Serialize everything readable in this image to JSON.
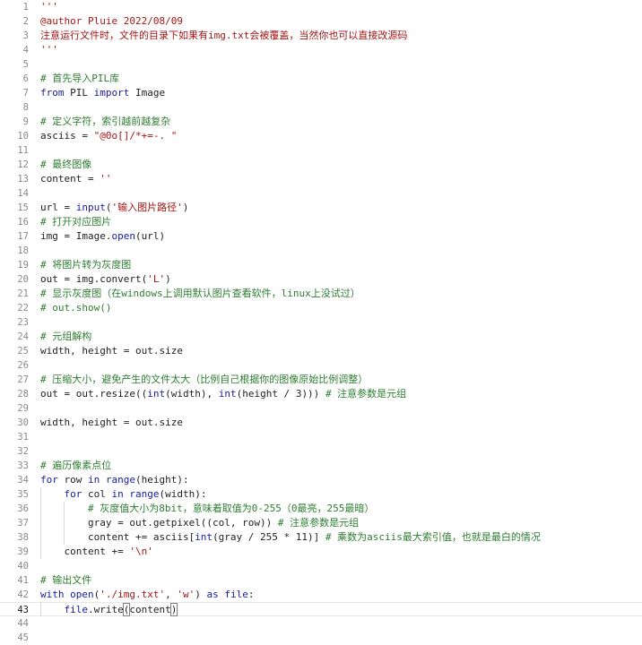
{
  "editor": {
    "colors": {
      "comment": "#2e7d32",
      "keyword": "#1a1aa6",
      "string": "#a31515",
      "plain": "#1f1f1f",
      "builtin": "#1a1aa6",
      "line_number": "#8a8a8a"
    },
    "current_line": 43,
    "lines": [
      {
        "n": 1,
        "tokens": [
          {
            "t": "'''",
            "c": "string"
          }
        ]
      },
      {
        "n": 2,
        "tokens": [
          {
            "t": "@author Pluie 2022/08/09",
            "c": "string"
          }
        ]
      },
      {
        "n": 3,
        "tokens": [
          {
            "t": "注意运行文件时，文件的目录下如果有img.txt会被覆盖，当然你也可以直接改源码",
            "c": "string"
          }
        ]
      },
      {
        "n": 4,
        "tokens": [
          {
            "t": "'''",
            "c": "string"
          }
        ]
      },
      {
        "n": 5,
        "tokens": []
      },
      {
        "n": 6,
        "tokens": [
          {
            "t": "# 首先导入PIL库",
            "c": "comment"
          }
        ]
      },
      {
        "n": 7,
        "tokens": [
          {
            "t": "from",
            "c": "keyword"
          },
          {
            "t": " PIL ",
            "c": "plain"
          },
          {
            "t": "import",
            "c": "keyword"
          },
          {
            "t": " Image",
            "c": "plain"
          }
        ]
      },
      {
        "n": 8,
        "tokens": []
      },
      {
        "n": 9,
        "tokens": [
          {
            "t": "# 定义字符，索引越前越复杂",
            "c": "comment"
          }
        ]
      },
      {
        "n": 10,
        "tokens": [
          {
            "t": "asciis = ",
            "c": "plain"
          },
          {
            "t": "\"@0o[]/*+=-. \"",
            "c": "string"
          }
        ]
      },
      {
        "n": 11,
        "tokens": []
      },
      {
        "n": 12,
        "tokens": [
          {
            "t": "# 最终图像",
            "c": "comment"
          }
        ]
      },
      {
        "n": 13,
        "tokens": [
          {
            "t": "content = ",
            "c": "plain"
          },
          {
            "t": "''",
            "c": "string"
          }
        ]
      },
      {
        "n": 14,
        "tokens": []
      },
      {
        "n": 15,
        "tokens": [
          {
            "t": "url = ",
            "c": "plain"
          },
          {
            "t": "input",
            "c": "builtin"
          },
          {
            "t": "(",
            "c": "plain"
          },
          {
            "t": "'输入图片路径'",
            "c": "string"
          },
          {
            "t": ")",
            "c": "plain"
          }
        ]
      },
      {
        "n": 16,
        "tokens": [
          {
            "t": "# 打开对应图片",
            "c": "comment"
          }
        ]
      },
      {
        "n": 17,
        "tokens": [
          {
            "t": "img = Image.",
            "c": "plain"
          },
          {
            "t": "open",
            "c": "builtin"
          },
          {
            "t": "(url)",
            "c": "plain"
          }
        ]
      },
      {
        "n": 18,
        "tokens": []
      },
      {
        "n": 19,
        "tokens": [
          {
            "t": "# 将图片转为灰度图",
            "c": "comment"
          }
        ]
      },
      {
        "n": 20,
        "tokens": [
          {
            "t": "out = img.convert(",
            "c": "plain"
          },
          {
            "t": "'L'",
            "c": "string"
          },
          {
            "t": ")",
            "c": "plain"
          }
        ]
      },
      {
        "n": 21,
        "tokens": [
          {
            "t": "# 显示灰度图（在windows上调用默认图片查看软件，linux上没试过）",
            "c": "comment"
          }
        ]
      },
      {
        "n": 22,
        "tokens": [
          {
            "t": "# out.show()",
            "c": "comment"
          }
        ]
      },
      {
        "n": 23,
        "tokens": []
      },
      {
        "n": 24,
        "tokens": [
          {
            "t": "# 元组解构",
            "c": "comment"
          }
        ]
      },
      {
        "n": 25,
        "tokens": [
          {
            "t": "width, height = out.size",
            "c": "plain"
          }
        ]
      },
      {
        "n": 26,
        "tokens": []
      },
      {
        "n": 27,
        "tokens": [
          {
            "t": "# 压缩大小，避免产生的文件太大（比例自己根据你的图像原始比例调整）",
            "c": "comment"
          }
        ]
      },
      {
        "n": 28,
        "tokens": [
          {
            "t": "out = out.resize((",
            "c": "plain"
          },
          {
            "t": "int",
            "c": "builtin"
          },
          {
            "t": "(width), ",
            "c": "plain"
          },
          {
            "t": "int",
            "c": "builtin"
          },
          {
            "t": "(height / ",
            "c": "plain"
          },
          {
            "t": "3",
            "c": "plain"
          },
          {
            "t": "))) ",
            "c": "plain"
          },
          {
            "t": "# 注意参数是元组",
            "c": "comment"
          }
        ]
      },
      {
        "n": 29,
        "tokens": []
      },
      {
        "n": 30,
        "tokens": [
          {
            "t": "width, height = out.size",
            "c": "plain"
          }
        ]
      },
      {
        "n": 31,
        "tokens": []
      },
      {
        "n": 32,
        "tokens": []
      },
      {
        "n": 33,
        "tokens": [
          {
            "t": "# 遍历像素点位",
            "c": "comment"
          }
        ]
      },
      {
        "n": 34,
        "tokens": [
          {
            "t": "for",
            "c": "keyword"
          },
          {
            "t": " row ",
            "c": "plain"
          },
          {
            "t": "in",
            "c": "keyword"
          },
          {
            "t": " ",
            "c": "plain"
          },
          {
            "t": "range",
            "c": "builtin"
          },
          {
            "t": "(height):",
            "c": "plain"
          }
        ]
      },
      {
        "n": 35,
        "tokens": [
          {
            "t": "    ",
            "c": "plain"
          },
          {
            "t": "for",
            "c": "keyword"
          },
          {
            "t": " col ",
            "c": "plain"
          },
          {
            "t": "in",
            "c": "keyword"
          },
          {
            "t": " ",
            "c": "plain"
          },
          {
            "t": "range",
            "c": "builtin"
          },
          {
            "t": "(width):",
            "c": "plain"
          }
        ]
      },
      {
        "n": 36,
        "tokens": [
          {
            "t": "        ",
            "c": "plain"
          },
          {
            "t": "# 灰度值大小为8bit，意味着取值为0-255（0最亮，255最暗）",
            "c": "comment"
          }
        ]
      },
      {
        "n": 37,
        "tokens": [
          {
            "t": "        gray = out.getpixel((col, row)) ",
            "c": "plain"
          },
          {
            "t": "# 注意参数是元组",
            "c": "comment"
          }
        ]
      },
      {
        "n": 38,
        "tokens": [
          {
            "t": "        content += asciis[",
            "c": "plain"
          },
          {
            "t": "int",
            "c": "builtin"
          },
          {
            "t": "(gray / ",
            "c": "plain"
          },
          {
            "t": "255",
            "c": "plain"
          },
          {
            "t": " * ",
            "c": "plain"
          },
          {
            "t": "11",
            "c": "plain"
          },
          {
            "t": ")] ",
            "c": "plain"
          },
          {
            "t": "# 乘数为asciis最大索引值，也就是最白的情况",
            "c": "comment"
          }
        ]
      },
      {
        "n": 39,
        "tokens": [
          {
            "t": "    content += ",
            "c": "plain"
          },
          {
            "t": "'\\n'",
            "c": "string"
          }
        ]
      },
      {
        "n": 40,
        "tokens": []
      },
      {
        "n": 41,
        "tokens": [
          {
            "t": "# 输出文件",
            "c": "comment"
          }
        ]
      },
      {
        "n": 42,
        "tokens": [
          {
            "t": "with",
            "c": "keyword"
          },
          {
            "t": " ",
            "c": "plain"
          },
          {
            "t": "open",
            "c": "builtin"
          },
          {
            "t": "(",
            "c": "plain"
          },
          {
            "t": "'./img.txt'",
            "c": "string"
          },
          {
            "t": ", ",
            "c": "plain"
          },
          {
            "t": "'w'",
            "c": "string"
          },
          {
            "t": ") ",
            "c": "plain"
          },
          {
            "t": "as",
            "c": "keyword"
          },
          {
            "t": " ",
            "c": "plain"
          },
          {
            "t": "file",
            "c": "builtin"
          },
          {
            "t": ":",
            "c": "plain"
          }
        ]
      },
      {
        "n": 43,
        "tokens": [
          {
            "t": "    ",
            "c": "plain"
          },
          {
            "t": "file",
            "c": "builtin"
          },
          {
            "t": ".write",
            "c": "plain"
          },
          {
            "t": "(",
            "c": "cursor"
          },
          {
            "t": "content",
            "c": "plain"
          },
          {
            "t": ")",
            "c": "cursor"
          }
        ]
      },
      {
        "n": 44,
        "tokens": []
      },
      {
        "n": 45,
        "tokens": []
      }
    ]
  }
}
